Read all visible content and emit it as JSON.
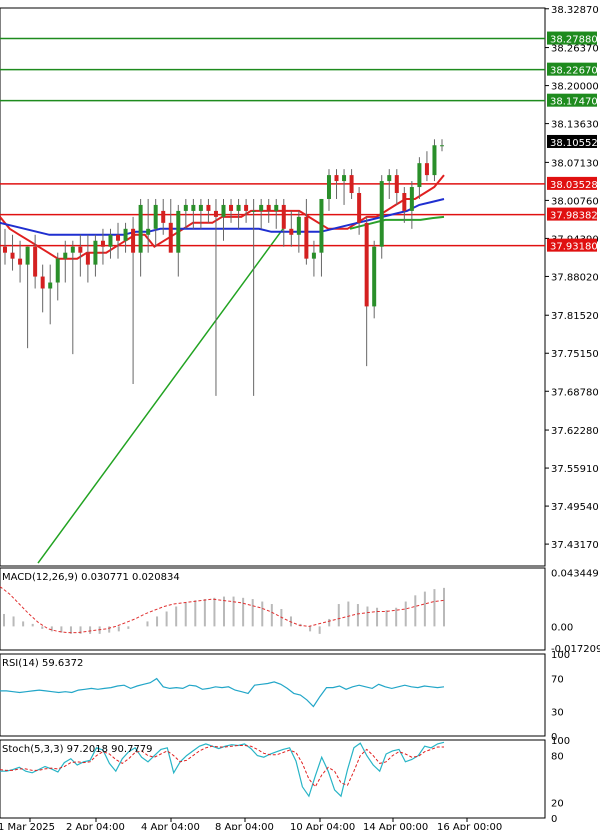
{
  "colors": {
    "background": "#ffffff",
    "bull": "#2a8f2a",
    "bear": "#d42020",
    "wick": "#666666",
    "resistance": "#1e8b1e",
    "support": "#e01010",
    "ma_fast": "#e02020",
    "ma_mid": "#1f2fd0",
    "ma_slow": "#2aa02a",
    "trend": "#22a322",
    "macd_hist": "#b9b9b9",
    "macd_signal": "#e03030",
    "rsi": "#22a6c8",
    "stoch_main": "#28b4c6",
    "stoch_signal": "#e02020",
    "price_badge": "#000000"
  },
  "chart_data": {
    "type": "candlestick",
    "price_axis": {
      "ylim": [
        37.395,
        38.33
      ],
      "ticks": [
        "38.32870",
        "38.26370",
        "38.20000",
        "38.13630",
        "38.07130",
        "38.00760",
        "37.94390",
        "37.88020",
        "37.81520",
        "37.75150",
        "37.68780",
        "37.62280",
        "37.55910",
        "37.49540",
        "37.43170"
      ]
    },
    "time_axis": {
      "labels": [
        "1 Mar 2025",
        "2 Apr 04:00",
        "4 Apr 04:00",
        "8 Apr 04:00",
        "10 Apr 04:00",
        "14 Apr 00:00",
        "16 Apr 00:00"
      ]
    },
    "current_price": "38.10552",
    "levels": {
      "resistance": [
        "38.27880",
        "38.22670",
        "38.17470"
      ],
      "support": [
        "38.03528",
        "37.98382",
        "37.93180"
      ]
    },
    "candles": [
      [
        37.93,
        37.96,
        37.9,
        37.92
      ],
      [
        37.92,
        37.95,
        37.89,
        37.91
      ],
      [
        37.91,
        37.94,
        37.87,
        37.9
      ],
      [
        37.9,
        37.93,
        37.76,
        37.93
      ],
      [
        37.93,
        37.95,
        37.86,
        37.88
      ],
      [
        37.88,
        37.9,
        37.82,
        37.86
      ],
      [
        37.86,
        37.9,
        37.8,
        37.87
      ],
      [
        37.87,
        37.92,
        37.84,
        37.91
      ],
      [
        37.91,
        37.94,
        37.87,
        37.92
      ],
      [
        37.92,
        37.94,
        37.75,
        37.93
      ],
      [
        37.93,
        37.95,
        37.88,
        37.92
      ],
      [
        37.92,
        37.95,
        37.87,
        37.9
      ],
      [
        37.9,
        37.95,
        37.88,
        37.94
      ],
      [
        37.94,
        37.96,
        37.9,
        37.93
      ],
      [
        37.93,
        37.96,
        37.91,
        37.95
      ],
      [
        37.95,
        37.97,
        37.91,
        37.94
      ],
      [
        37.94,
        37.97,
        37.92,
        37.96
      ],
      [
        37.96,
        37.98,
        37.7,
        37.92
      ],
      [
        37.92,
        38.01,
        37.88,
        38.0
      ],
      [
        37.95,
        38.01,
        37.92,
        37.96
      ],
      [
        37.96,
        38.01,
        37.93,
        38.0
      ],
      [
        37.99,
        38.01,
        37.95,
        37.97
      ],
      [
        37.97,
        38.01,
        37.94,
        37.92
      ],
      [
        37.92,
        38.0,
        37.88,
        37.99
      ],
      [
        37.99,
        38.01,
        37.96,
        38.0
      ],
      [
        37.99,
        38.01,
        37.96,
        38.0
      ],
      [
        37.99,
        38.01,
        37.96,
        38.0
      ],
      [
        38.0,
        38.01,
        37.97,
        37.99
      ],
      [
        37.99,
        38.01,
        37.68,
        37.98
      ],
      [
        37.98,
        38.01,
        37.94,
        38.0
      ],
      [
        38.0,
        38.01,
        37.97,
        37.99
      ],
      [
        37.99,
        38.01,
        37.96,
        38.0
      ],
      [
        38.0,
        38.01,
        37.97,
        37.99
      ],
      [
        37.99,
        38.01,
        37.68,
        37.99
      ],
      [
        37.99,
        38.01,
        37.96,
        38.0
      ],
      [
        38.0,
        38.01,
        37.97,
        37.99
      ],
      [
        37.99,
        38.01,
        37.96,
        38.0
      ],
      [
        38.0,
        38.01,
        37.93,
        37.96
      ],
      [
        37.96,
        37.99,
        37.93,
        37.95
      ],
      [
        37.95,
        37.99,
        37.92,
        37.98
      ],
      [
        37.98,
        38.01,
        37.9,
        37.91
      ],
      [
        37.91,
        37.94,
        37.88,
        37.92
      ],
      [
        37.92,
        38.01,
        37.88,
        38.01
      ],
      [
        38.01,
        38.06,
        37.99,
        38.05
      ],
      [
        38.05,
        38.06,
        38.01,
        38.04
      ],
      [
        38.04,
        38.06,
        38.0,
        38.05
      ],
      [
        38.05,
        38.06,
        38.01,
        38.02
      ],
      [
        38.02,
        38.03,
        37.95,
        37.97
      ],
      [
        37.97,
        37.98,
        37.73,
        37.83
      ],
      [
        37.83,
        37.94,
        37.81,
        37.93
      ],
      [
        37.93,
        38.05,
        37.91,
        38.04
      ],
      [
        38.04,
        38.06,
        38.01,
        38.05
      ],
      [
        38.05,
        38.06,
        38.0,
        38.02
      ],
      [
        38.02,
        38.03,
        37.97,
        37.99
      ],
      [
        37.99,
        38.04,
        37.96,
        38.03
      ],
      [
        38.03,
        38.08,
        38.01,
        38.07
      ],
      [
        38.07,
        38.09,
        38.04,
        38.05
      ],
      [
        38.05,
        38.11,
        38.04,
        38.1
      ],
      [
        38.1,
        38.11,
        38.09,
        38.1
      ]
    ],
    "indicators": {
      "ma_fast": [
        37.98,
        37.96,
        37.95,
        37.94,
        37.93,
        37.92,
        37.91,
        37.91,
        37.91,
        37.92,
        37.92,
        37.92,
        37.93,
        37.94,
        37.95,
        37.95,
        37.93,
        37.94,
        37.95,
        37.96,
        37.97,
        37.97,
        37.97,
        37.98,
        37.98,
        37.98,
        37.99,
        37.99,
        37.99,
        37.99,
        37.99,
        37.99,
        37.98,
        37.97,
        37.96,
        37.96,
        37.96,
        37.97,
        37.98,
        37.98,
        37.99,
        38.0,
        38.01,
        38.01,
        38.02,
        38.03,
        38.05
      ],
      "ma_mid": [
        37.97,
        37.965,
        37.96,
        37.955,
        37.95,
        37.95,
        37.95,
        37.95,
        37.95,
        37.95,
        37.95,
        37.955,
        37.955,
        37.96,
        37.96,
        37.96,
        37.96,
        37.96,
        37.96,
        37.96,
        37.96,
        37.96,
        37.955,
        37.955,
        37.955,
        37.955,
        37.955,
        37.96,
        37.965,
        37.97,
        37.975,
        37.98,
        37.985,
        37.99,
        38.0,
        38.005,
        38.01
      ],
      "ma_slow": [
        37.96,
        37.965,
        37.97,
        37.975,
        37.975,
        37.975,
        37.975,
        37.978,
        37.98
      ],
      "trend": [
        [
          37.4,
          0
        ],
        [
          37.96,
          1
        ]
      ]
    },
    "macd": {
      "label": "MACD(12,26,9) 0.030771 0.020834",
      "ylim": [
        -0.019,
        0.047
      ],
      "ticks": [
        "0.043449",
        "0.00",
        "-0.017209"
      ],
      "histogram": [
        0.01,
        0.008,
        0.004,
        0.002,
        -0.002,
        -0.004,
        -0.005,
        -0.006,
        -0.006,
        -0.006,
        -0.006,
        -0.005,
        -0.004,
        -0.002,
        0.0,
        0.004,
        0.008,
        0.012,
        0.016,
        0.019,
        0.021,
        0.022,
        0.023,
        0.024,
        0.024,
        0.023,
        0.022,
        0.02,
        0.018,
        0.014,
        0.008,
        0.002,
        -0.004,
        -0.006,
        0.006,
        0.018,
        0.02,
        0.018,
        0.016,
        0.015,
        0.013,
        0.015,
        0.02,
        0.025,
        0.028,
        0.03,
        0.031
      ],
      "signal": [
        0.032,
        0.026,
        0.018,
        0.01,
        0.003,
        -0.002,
        -0.004,
        -0.005,
        -0.005,
        -0.004,
        -0.003,
        -0.002,
        0.0,
        0.003,
        0.006,
        0.01,
        0.013,
        0.016,
        0.018,
        0.019,
        0.02,
        0.021,
        0.022,
        0.021,
        0.02,
        0.019,
        0.017,
        0.015,
        0.012,
        0.008,
        0.004,
        0.001,
        0.0,
        0.002,
        0.004,
        0.006,
        0.008,
        0.01,
        0.011,
        0.012,
        0.012,
        0.013,
        0.014,
        0.016,
        0.018,
        0.02,
        0.021
      ]
    },
    "rsi": {
      "label": "RSI(14) 59.6372",
      "ylim": [
        0,
        100
      ],
      "ticks": [
        "100",
        "70",
        "30",
        "0"
      ],
      "values": [
        55,
        55,
        54,
        53,
        54,
        55,
        56,
        55,
        54,
        53,
        54,
        53,
        56,
        57,
        58,
        57,
        58,
        59,
        61,
        62,
        58,
        61,
        63,
        65,
        70,
        60,
        58,
        59,
        58,
        62,
        61,
        57,
        58,
        60,
        59,
        60,
        56,
        54,
        52,
        62,
        63,
        64,
        66,
        63,
        58,
        52,
        50,
        44,
        36,
        48,
        59,
        59,
        61,
        57,
        60,
        62,
        60,
        58,
        63,
        60,
        58,
        60,
        62,
        60,
        59,
        61,
        60,
        59,
        60
      ]
    },
    "stoch": {
      "label": "Stoch(5,3,3) 97.2018 90.7779",
      "ylim": [
        0,
        100
      ],
      "ticks": [
        "100",
        "80",
        "20",
        "0"
      ],
      "main": [
        60,
        60,
        62,
        65,
        60,
        58,
        62,
        66,
        63,
        59,
        71,
        76,
        68,
        72,
        74,
        90,
        87,
        70,
        60,
        76,
        85,
        90,
        78,
        72,
        80,
        88,
        90,
        58,
        72,
        80,
        86,
        92,
        95,
        92,
        89,
        92,
        94,
        93,
        95,
        89,
        80,
        78,
        82,
        85,
        88,
        90,
        73,
        40,
        28,
        54,
        78,
        60,
        36,
        28,
        62,
        90,
        96,
        80,
        68,
        60,
        82,
        86,
        88,
        72,
        75,
        80,
        92,
        90,
        95,
        97
      ],
      "signal": [
        62,
        61,
        61,
        63,
        63,
        61,
        61,
        63,
        64,
        63,
        66,
        71,
        72,
        71,
        72,
        80,
        85,
        82,
        75,
        70,
        76,
        84,
        86,
        80,
        78,
        82,
        86,
        80,
        72,
        74,
        80,
        86,
        90,
        92,
        91,
        91,
        92,
        93,
        93,
        92,
        88,
        83,
        81,
        81,
        84,
        87,
        84,
        70,
        50,
        40,
        55,
        65,
        60,
        45,
        42,
        60,
        80,
        88,
        80,
        70,
        72,
        80,
        85,
        82,
        78,
        79,
        85,
        88,
        91,
        91
      ]
    }
  }
}
